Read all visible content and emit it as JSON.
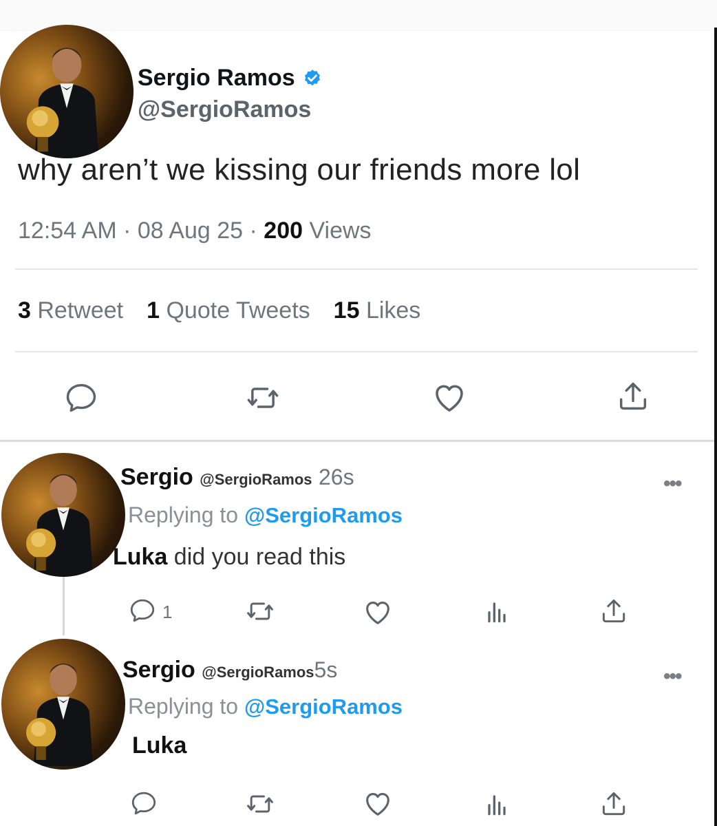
{
  "tweet": {
    "author_name": "Sergio Ramos",
    "author_handle": "@SergioRamos",
    "text": "why aren’t we kissing our friends more lol",
    "time": "12:54 AM",
    "date": "08 Aug 25",
    "views_count": "200",
    "views_label": "Views",
    "sep": "·",
    "stats": {
      "retweets_count": "3",
      "retweets_label": "Retweet",
      "quotes_count": "1",
      "quotes_label": "Quote Tweets",
      "likes_count": "15",
      "likes_label": "Likes"
    },
    "actions": [
      "reply-icon",
      "retweet-icon",
      "like-icon",
      "share-icon"
    ]
  },
  "replies": [
    {
      "name": "Sergio",
      "handle": "@SergioRamos",
      "time": "26s",
      "replying_label": "Replying to",
      "replying_handle": "@SergioRamos",
      "text_bold": "Luka",
      "text_rest": " did you read this",
      "reply_count": "1",
      "more": "•••"
    },
    {
      "name": "Sergio",
      "handle": "@SergioRamos",
      "time": "5s",
      "replying_label": "Replying to",
      "replying_handle": "@SergioRamos",
      "text_bold": "Luka",
      "text_rest": "",
      "reply_count": "",
      "more": "•••"
    }
  ],
  "colors": {
    "link": "#1d9bf0",
    "muted": "#6e767d",
    "text": "#0f1419"
  }
}
